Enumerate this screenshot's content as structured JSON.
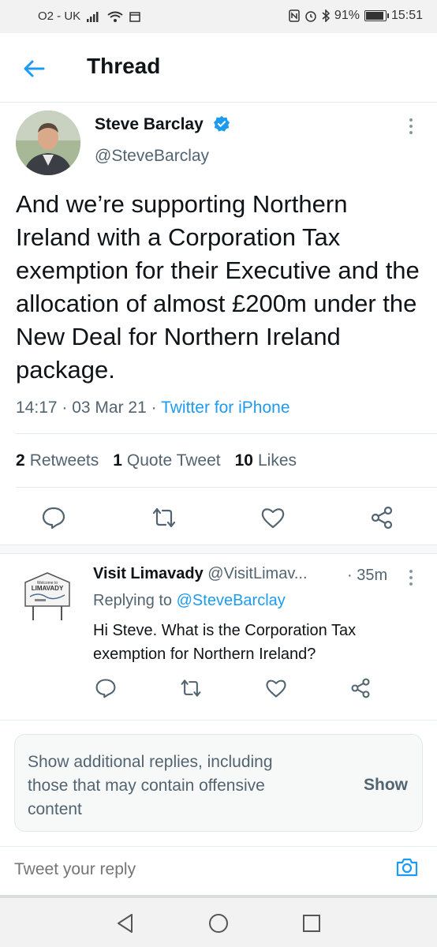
{
  "status_bar": {
    "carrier": "O2 - UK",
    "battery_percent": "91%",
    "battery_level": 0.91,
    "time": "15:51"
  },
  "header": {
    "title": "Thread"
  },
  "tweet": {
    "author_name": "Steve Barclay",
    "author_handle": "@SteveBarclay",
    "text": "And we’re supporting Northern Ireland with a Corporation Tax exemption for their Executive and the allocation of almost £200m under the New Deal for Northern Ireland package.",
    "time": "14:17",
    "date": "03 Mar 21",
    "source": "Twitter for iPhone",
    "stats": {
      "retweets_count": "2",
      "retweets_label": "Retweets",
      "quotes_count": "1",
      "quotes_label": "Quote Tweet",
      "likes_count": "10",
      "likes_label": "Likes"
    }
  },
  "reply": {
    "author_name": "Visit Limavady",
    "author_handle": "@VisitLimav...",
    "time": "35m",
    "replying_prefix": "Replying to",
    "replying_to": "@SteveBarclay",
    "text": "Hi Steve. What is the Corporation Tax exemption for Northern Ireland?",
    "avatar_sign": {
      "line1": "Welcome to",
      "line2": "LIMAVADY"
    }
  },
  "show_more": {
    "text": "Show additional replies, including those that may contain offensive content",
    "button": "Show"
  },
  "composer": {
    "placeholder": "Tweet your reply"
  },
  "colors": {
    "accent": "#1d9bf0",
    "text": "#0f1419",
    "secondary": "#536471"
  }
}
